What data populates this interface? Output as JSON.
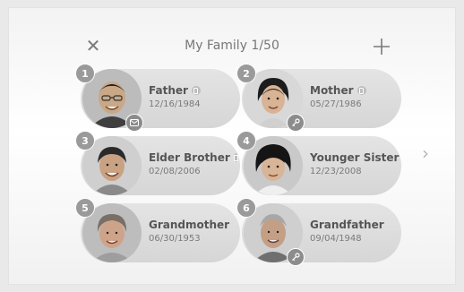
{
  "header": {
    "title": "My Family 1/50",
    "close_glyph": "✕",
    "add_icon": "plus-icon",
    "next_glyph": "›"
  },
  "members": [
    {
      "number": "1",
      "name": "Father",
      "date": "12/16/1984",
      "has_phone_icon": true,
      "corner_icon": "message-icon"
    },
    {
      "number": "2",
      "name": "Mother",
      "date": "05/27/1986",
      "has_phone_icon": true,
      "corner_icon": "key-icon"
    },
    {
      "number": "3",
      "name": "Elder Brother",
      "date": "02/08/2006",
      "has_phone_icon": true,
      "corner_icon": ""
    },
    {
      "number": "4",
      "name": "Younger Sister",
      "date": "12/23/2008",
      "has_phone_icon": false,
      "corner_icon": ""
    },
    {
      "number": "5",
      "name": "Grandmother",
      "date": "06/30/1953",
      "has_phone_icon": false,
      "corner_icon": ""
    },
    {
      "number": "6",
      "name": "Grandfather",
      "date": "09/04/1948",
      "has_phone_icon": false,
      "corner_icon": "key-icon"
    }
  ],
  "colors": {
    "card_bg": "#dddddd",
    "badge_bg": "#9a9a9a",
    "text_primary": "#555555",
    "text_secondary": "#7a7a7a"
  }
}
